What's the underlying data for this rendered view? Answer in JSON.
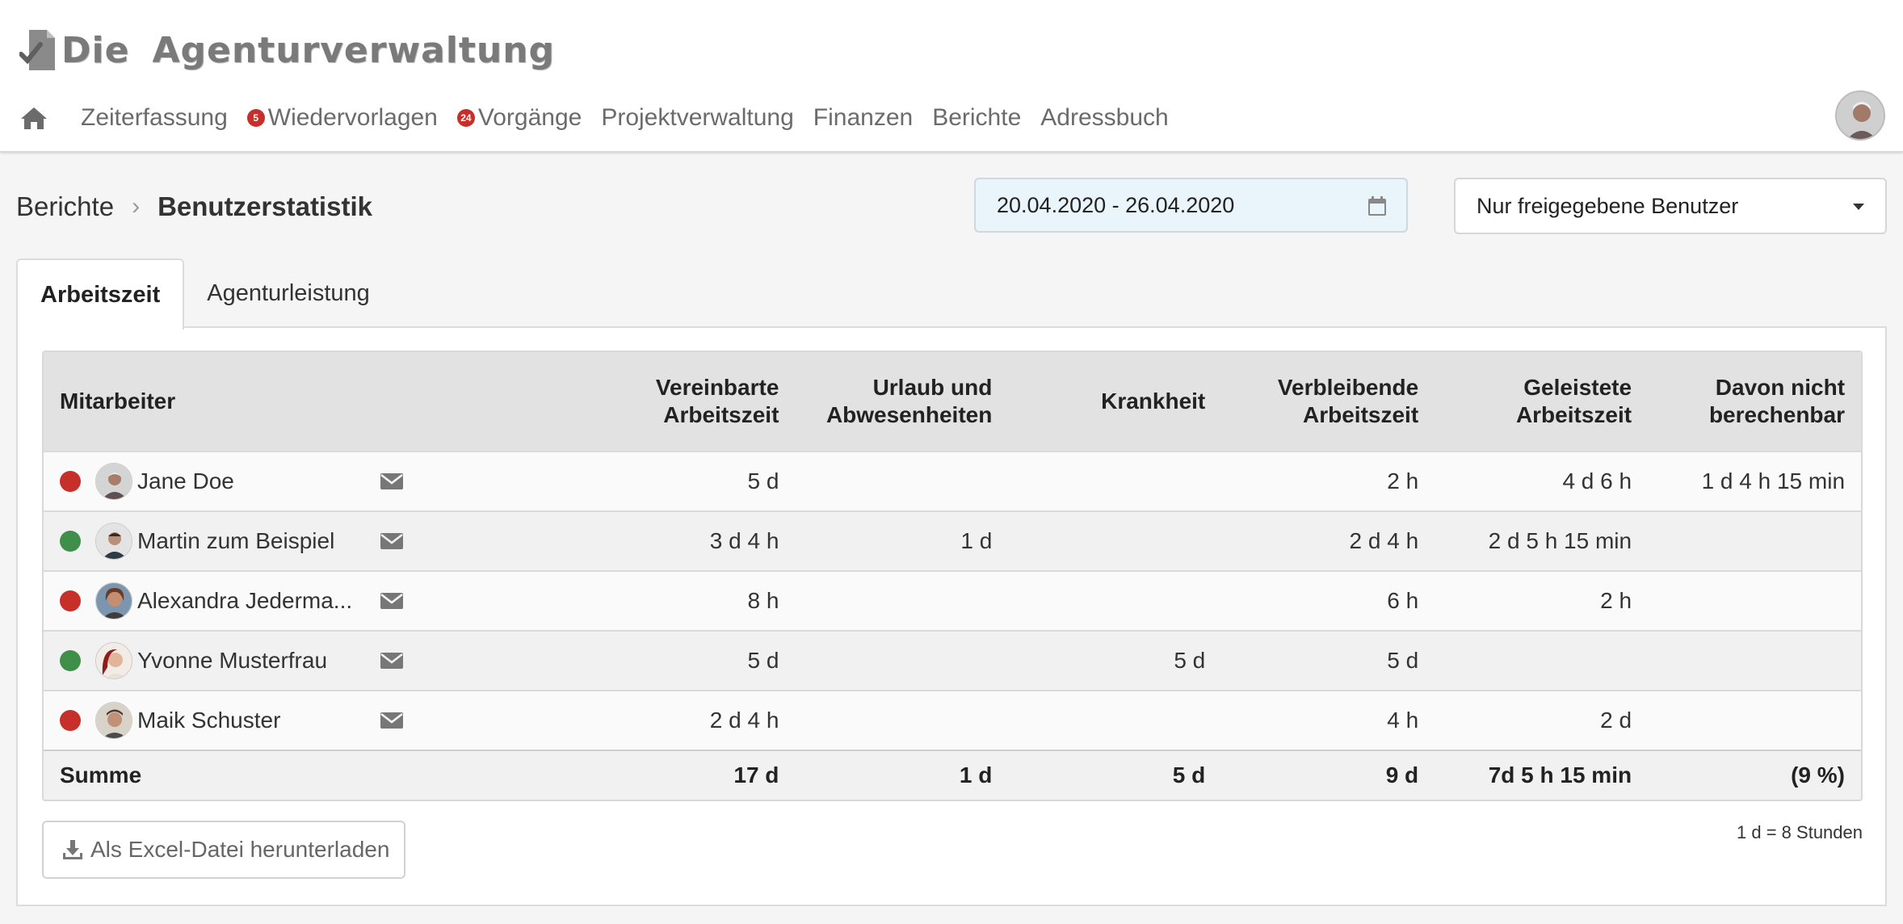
{
  "app": {
    "logo_word1": "Die",
    "logo_word2": "Agenturverwaltung"
  },
  "nav": {
    "home_icon": "home-icon",
    "items": [
      {
        "label": "Zeiterfassung"
      },
      {
        "label": "Wiedervorlagen",
        "badge": "5"
      },
      {
        "label": "Vorgänge",
        "badge": "24"
      },
      {
        "label": "Projektverwaltung"
      },
      {
        "label": "Finanzen"
      },
      {
        "label": "Berichte"
      },
      {
        "label": "Adressbuch"
      }
    ],
    "badge_color": "#c62f2a"
  },
  "breadcrumb": {
    "root": "Berichte",
    "current": "Benutzerstatistik"
  },
  "filters": {
    "date_range": "20.04.2020 - 26.04.2020",
    "user_filter": "Nur freigegebene Benutzer"
  },
  "tabs": [
    {
      "label": "Arbeitszeit",
      "active": true
    },
    {
      "label": "Agenturleistung",
      "active": false
    }
  ],
  "table": {
    "headers": {
      "name": "Mitarbeiter",
      "agreed": "Vereinbarte Arbeitszeit",
      "leave": "Urlaub und Abwesenheiten",
      "sick": "Krankheit",
      "remaining": "Verbleibende Arbeitszeit",
      "worked": "Geleistete Arbeitszeit",
      "nonbillable": "Davon nicht berechenbar"
    },
    "rows": [
      {
        "status": "red",
        "name": "Jane Doe",
        "agreed": "5 d",
        "leave": "",
        "sick": "",
        "remaining": "2 h",
        "worked": "4 d 6 h",
        "nonbillable": "1 d 4 h 15 min"
      },
      {
        "status": "green",
        "name": "Martin zum Beispiel",
        "agreed": "3 d 4 h",
        "leave": "1 d",
        "sick": "",
        "remaining": "2 d 4 h",
        "worked": "2 d 5 h 15 min",
        "nonbillable": ""
      },
      {
        "status": "red",
        "name": "Alexandra Jederma...",
        "agreed": "8 h",
        "leave": "",
        "sick": "",
        "remaining": "6 h",
        "worked": "2 h",
        "nonbillable": ""
      },
      {
        "status": "green",
        "name": "Yvonne Musterfrau",
        "agreed": "5 d",
        "leave": "",
        "sick": "5 d",
        "remaining": "5 d",
        "worked": "",
        "nonbillable": ""
      },
      {
        "status": "red",
        "name": "Maik Schuster",
        "agreed": "2 d 4 h",
        "leave": "",
        "sick": "",
        "remaining": "4 h",
        "worked": "2 d",
        "nonbillable": ""
      }
    ],
    "sum": {
      "label": "Summe",
      "agreed": "17 d",
      "leave": "1 d",
      "sick": "5 d",
      "remaining": "9 d",
      "worked": "7d 5 h 15 min",
      "nonbillable": "(9 %)"
    }
  },
  "footer": {
    "download_label": "Als Excel-Datei herunterladen",
    "note": "1 d = 8 Stunden"
  },
  "colors": {
    "status_red": "#c62f2a",
    "status_green": "#3f8f4a"
  }
}
